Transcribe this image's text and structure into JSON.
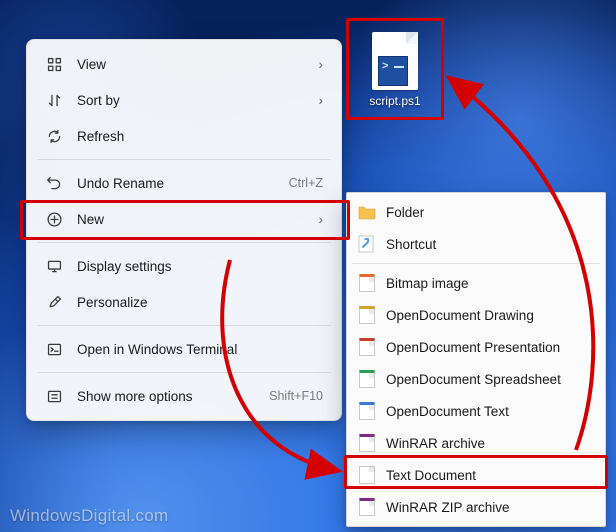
{
  "desktop": {
    "icon_label": "script.ps1"
  },
  "context_menu": {
    "items": [
      {
        "label": "View",
        "icon": "grid-icon",
        "has_submenu": true
      },
      {
        "label": "Sort by",
        "icon": "sort-icon",
        "has_submenu": true
      },
      {
        "label": "Refresh",
        "icon": "refresh-icon",
        "has_submenu": false
      },
      "sep",
      {
        "label": "Undo Rename",
        "icon": "undo-icon",
        "shortcut": "Ctrl+Z"
      },
      {
        "label": "New",
        "icon": "plus-icon",
        "has_submenu": true,
        "highlighted": true
      },
      "sep",
      {
        "label": "Display settings",
        "icon": "display-icon"
      },
      {
        "label": "Personalize",
        "icon": "brush-icon"
      },
      "sep",
      {
        "label": "Open in Windows Terminal",
        "icon": "terminal-icon"
      },
      "sep",
      {
        "label": "Show more options",
        "icon": "more-icon",
        "shortcut": "Shift+F10"
      }
    ]
  },
  "new_submenu": {
    "items": [
      {
        "label": "Folder",
        "icon": "folder",
        "color": "#f7c24b"
      },
      {
        "label": "Shortcut",
        "icon": "shortcut",
        "color": "#3286e6"
      },
      "sep",
      {
        "label": "Bitmap image",
        "icon": "file",
        "color": "#e36a2e"
      },
      {
        "label": "OpenDocument Drawing",
        "icon": "file",
        "color": "#d6a328"
      },
      {
        "label": "OpenDocument Presentation",
        "icon": "file",
        "color": "#c83f2c"
      },
      {
        "label": "OpenDocument Spreadsheet",
        "icon": "file",
        "color": "#2e9e55"
      },
      {
        "label": "OpenDocument Text",
        "icon": "file",
        "color": "#3b7cc9"
      },
      {
        "label": "WinRAR archive",
        "icon": "file",
        "color": "#7d2a84"
      },
      {
        "label": "Text Document",
        "icon": "file",
        "color": "#9aa4ad",
        "highlighted": true
      },
      {
        "label": "WinRAR ZIP archive",
        "icon": "file",
        "color": "#7d2a84"
      }
    ]
  },
  "watermark": "WindowsDigital.com"
}
